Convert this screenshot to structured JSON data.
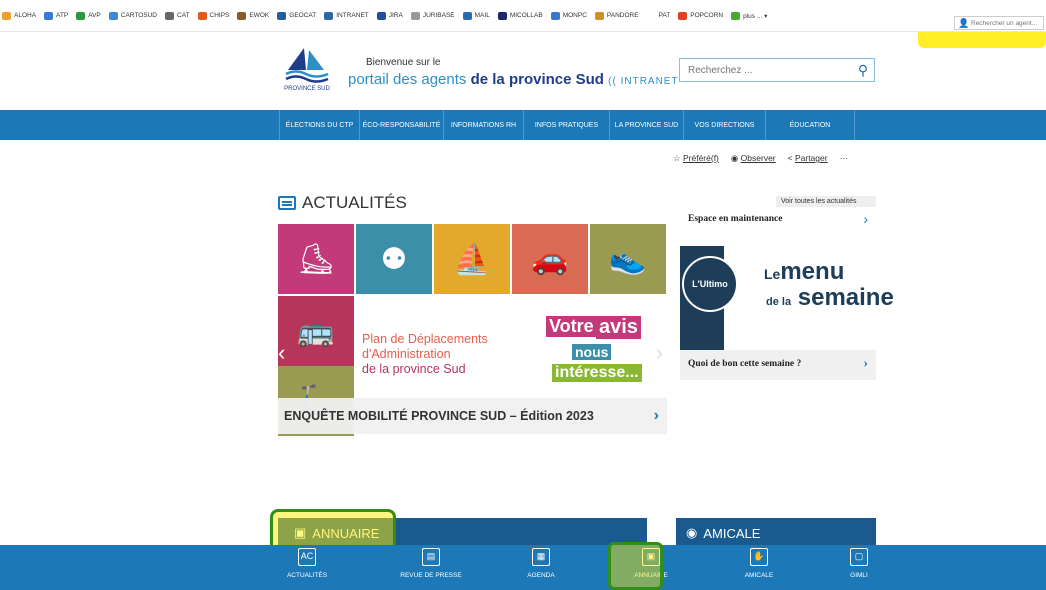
{
  "bookmarks": [
    {
      "label": "ALOHA",
      "color": "#f0a030"
    },
    {
      "label": "ATP",
      "color": "#3a7bd5"
    },
    {
      "label": "AVP",
      "color": "#2a9a40"
    },
    {
      "label": "CARTOSUD",
      "color": "#3a8ad5"
    },
    {
      "label": "CAT",
      "color": "#666666"
    },
    {
      "label": "CHIPS",
      "color": "#e05a20"
    },
    {
      "label": "EWOK",
      "color": "#8a5a2a"
    },
    {
      "label": "GEOCAT",
      "color": "#2060a0"
    },
    {
      "label": "INTRANET",
      "color": "#2a6aaa"
    },
    {
      "label": "JIRA",
      "color": "#2050a0"
    },
    {
      "label": "JURIBASE",
      "color": "#999999"
    },
    {
      "label": "MAIL",
      "color": "#2a6ab0"
    },
    {
      "label": "MICOLLAB",
      "color": "#1a2a6a"
    },
    {
      "label": "MONPC",
      "color": "#3a7ac5"
    },
    {
      "label": "PANDORE",
      "color": "#d09020"
    },
    {
      "label": "PAT",
      "color": "#ffffff"
    },
    {
      "label": "POPCORN",
      "color": "#e04020"
    },
    {
      "label": "plus ... ▾",
      "color": "#4aaa30"
    }
  ],
  "agent_search": {
    "placeholder": "Rechercher un agent..."
  },
  "header": {
    "welcome": "Bienvenue sur le",
    "portal_prefix": "portail des agents",
    "portal_middle": "de la province Sud",
    "portal_suffix": "(( INTRANET",
    "logo_text": "PROVINCE SUD",
    "search_placeholder": "Recherchez ..."
  },
  "nav": [
    {
      "label": "ÉLECTIONS DU CTP",
      "width": 80
    },
    {
      "label": "ÉCO-RESPONSABILITÉ",
      "width": 84
    },
    {
      "label": "INFORMATIONS RH",
      "width": 80
    },
    {
      "label": "INFOS PRATIQUES",
      "width": 86
    },
    {
      "label": "LA PROVINCE SUD",
      "width": 74
    },
    {
      "label": "VOS DIRECTIONS",
      "width": 82
    },
    {
      "label": "ÉDUCATION",
      "width": 90
    }
  ],
  "actions": {
    "prefere": "Préféré(f)",
    "observer": "Observer",
    "partager": "Partager",
    "more": "···"
  },
  "actualites": {
    "title": "ACTUALITÉS",
    "voir_toutes": "Voir toutes les actualités",
    "tiles": [
      {
        "color": "#c23a7a",
        "glyph": "⛸"
      },
      {
        "color": "#3b8fa8",
        "glyph": "⚉"
      },
      {
        "color": "#e2a92e",
        "glyph": "⛵"
      },
      {
        "color": "#d96b55",
        "glyph": "🚗"
      },
      {
        "color": "#9a9a52",
        "glyph": "👟"
      }
    ],
    "slide_title_1": "Plan de Déplacements",
    "slide_title_2": "d'Administration",
    "slide_title_3": "de la province Sud",
    "avis_1": "Votre",
    "avis_2": "avis",
    "avis_3": "nous",
    "avis_4": "intéresse...",
    "caption": "ENQUÊTE MOBILITÉ PROVINCE SUD – Édition 2023"
  },
  "maintenance": {
    "title": "Espace en maintenance"
  },
  "menu": {
    "badge": "L'Ultimo",
    "line1_small": "Le",
    "line1": "menu",
    "line2_small": "de la",
    "line2": "semaine",
    "caption": "Quoi de bon cette semaine ?"
  },
  "sections": {
    "annuaire": "ANNUAIRE",
    "amicale": "AMICALE"
  },
  "bottom": [
    {
      "label": "ACTUALITÉS",
      "glyph": "AC"
    },
    {
      "label": "REVUE DE PRESSE",
      "glyph": "▤"
    },
    {
      "label": "AGENDA",
      "glyph": "▦"
    },
    {
      "label": "ANNUAIRE",
      "glyph": "▣"
    },
    {
      "label": "AMICALE",
      "glyph": "✋"
    },
    {
      "label": "GIMLI",
      "glyph": "▢"
    }
  ],
  "colors": {
    "primary": "#1c78b6",
    "dark_blue": "#1a5a8f",
    "highlight_yellow": "#ffeb00",
    "highlight_green": "#2f8f16"
  }
}
